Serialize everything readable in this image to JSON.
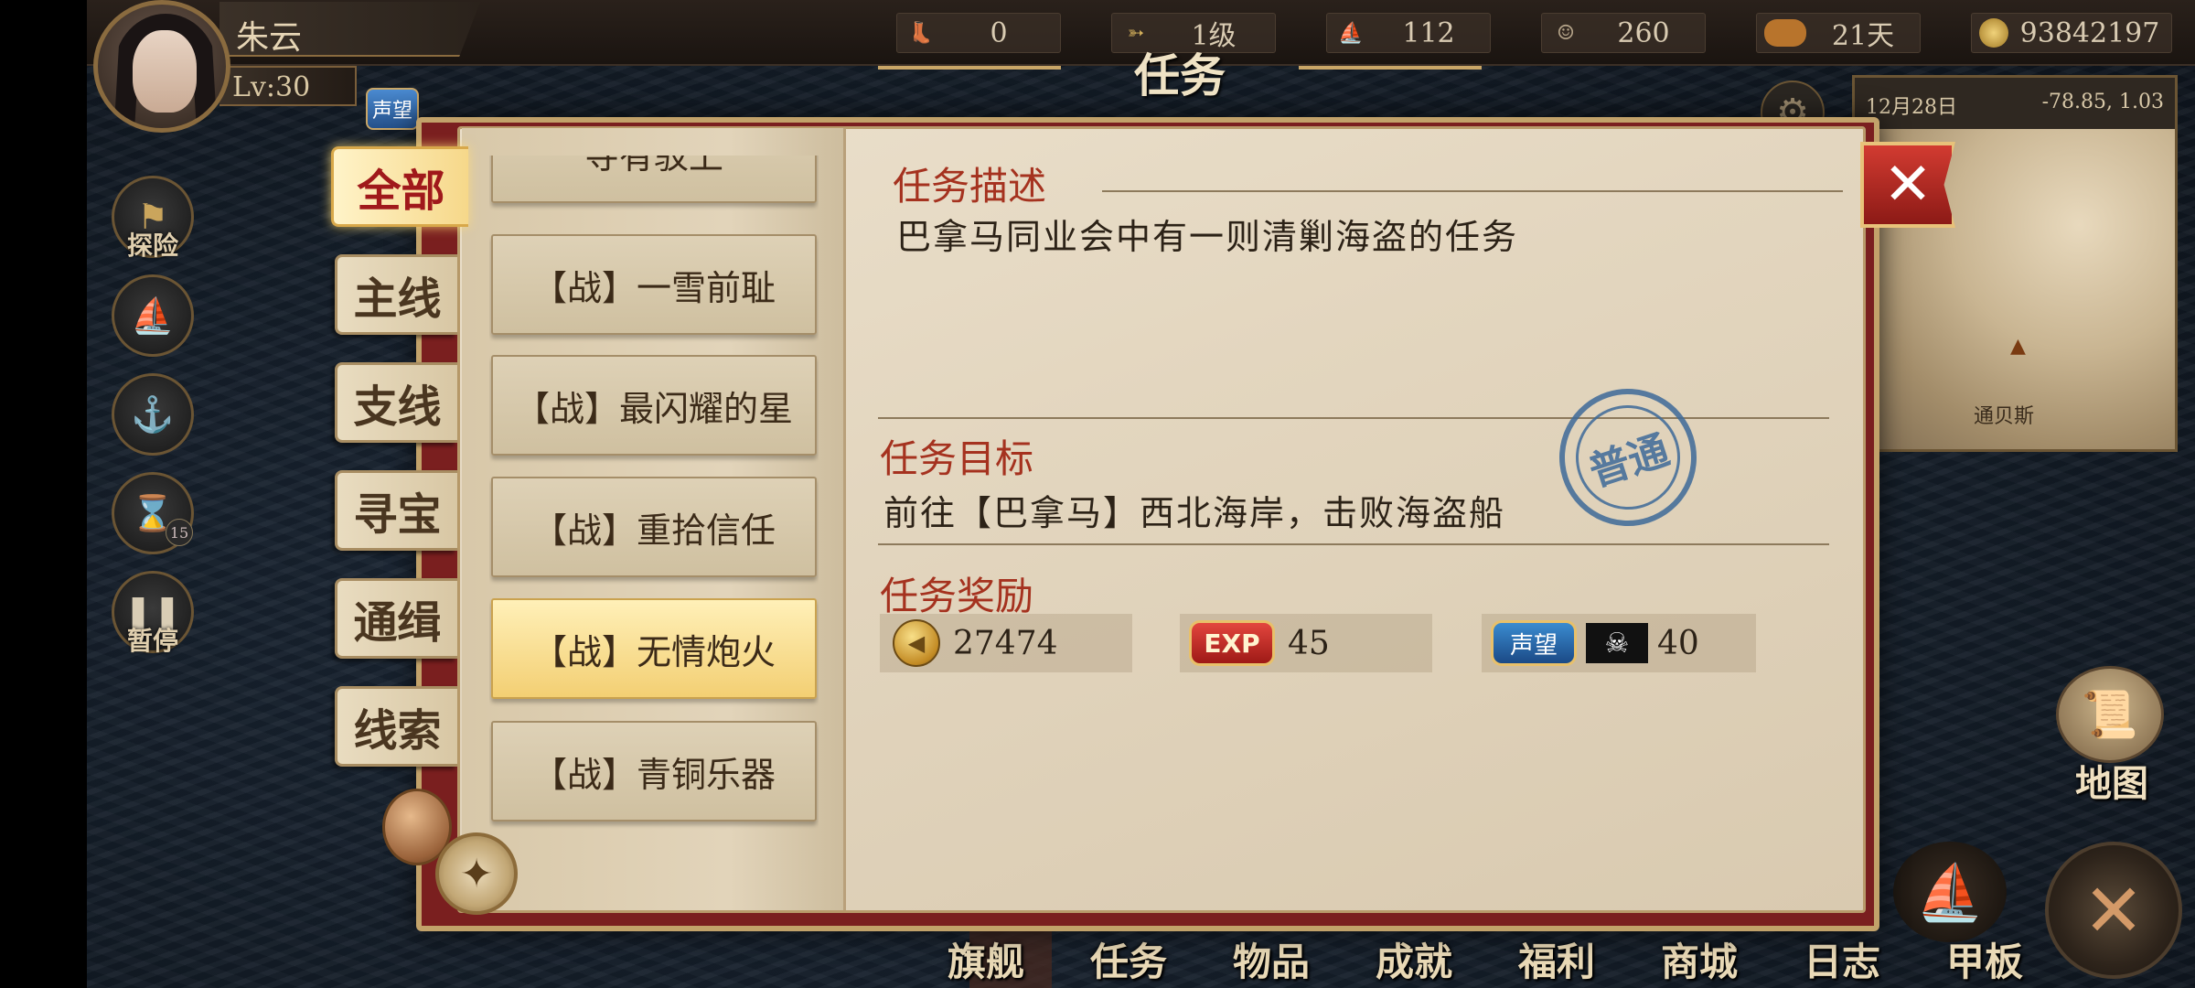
{
  "player": {
    "name": "朱云",
    "level": "Lv:30"
  },
  "resources": [
    {
      "icon": "boot-icon",
      "glyph": "",
      "value": "0"
    },
    {
      "icon": "arrows-icon",
      "glyph": "➳",
      "value": "1级"
    },
    {
      "icon": "red-ship-icon",
      "glyph": "",
      "value": "112"
    },
    {
      "icon": "sailor-icon",
      "glyph": "",
      "value": "260"
    },
    {
      "icon": "bread-icon",
      "glyph": "",
      "value": "21天"
    },
    {
      "icon": "gold-coin-icon",
      "glyph": "",
      "value": "93842197"
    }
  ],
  "title": "任务",
  "chips": {
    "reputation": "声望"
  },
  "side_buttons": [
    {
      "label": "探险",
      "icon": "flag-icon"
    },
    {
      "label": "",
      "icon": "ship-icon"
    },
    {
      "label": "",
      "icon": "anchor-icon"
    },
    {
      "label": "",
      "icon": "hourglass-icon",
      "badge": "15"
    },
    {
      "label": "暂停",
      "icon": "pause-icon"
    }
  ],
  "categories": [
    "全部",
    "主线",
    "支线",
    "寻宝",
    "通缉",
    "线索"
  ],
  "active_category": "全部",
  "quests": [
    {
      "label": "寺有驳上",
      "selected": false
    },
    {
      "label": "【战】一雪前耻",
      "selected": false
    },
    {
      "label": "【战】最闪耀的星",
      "selected": false
    },
    {
      "label": "【战】重拾信任",
      "selected": false
    },
    {
      "label": "【战】无情炮火",
      "selected": true
    },
    {
      "label": "【战】青铜乐器",
      "selected": false
    }
  ],
  "detail": {
    "desc_title": "任务描述",
    "desc_text": "巴拿马同业会中有一则清剿海盗的任务",
    "goal_title": "任务目标",
    "goal_text": "前往【巴拿马】西北海岸，击败海盗船",
    "reward_title": "任务奖励",
    "stamp": "普通",
    "rewards": {
      "gold": "27474",
      "exp_label": "EXP",
      "exp": "45",
      "rep_label": "声望",
      "rep": "40"
    }
  },
  "minimap": {
    "date": "12月28日",
    "coords": "-78.85, 1.03",
    "town": "通贝斯"
  },
  "map_button": "地图",
  "bottom_menu": [
    "旗舰",
    "任务",
    "物品",
    "成就",
    "福利",
    "商城",
    "日志",
    "甲板"
  ],
  "colors": {
    "accent_red": "#a5321f",
    "frame_red": "#7a1f1f",
    "gold_trim": "#c2a26a",
    "stamp_blue": "#3e6a99"
  }
}
